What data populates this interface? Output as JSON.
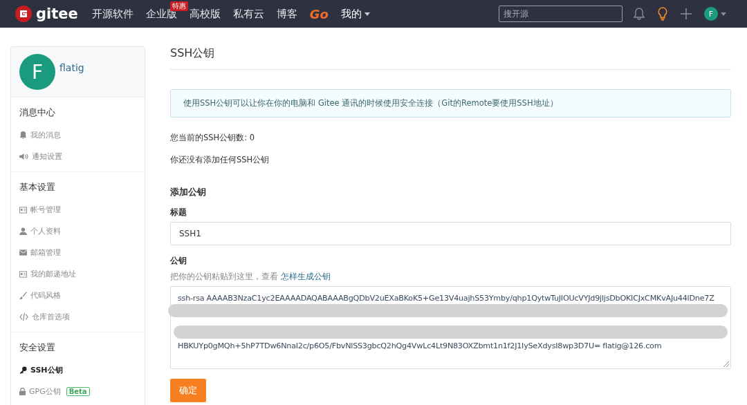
{
  "navbar": {
    "logo": "gitee",
    "items": [
      {
        "label": "开源软件",
        "kind": "plain"
      },
      {
        "label": "企业版",
        "kind": "plain",
        "badge": "特惠"
      },
      {
        "label": "高校版",
        "kind": "plain"
      },
      {
        "label": "私有云",
        "kind": "plain"
      },
      {
        "label": "博客",
        "kind": "plain"
      },
      {
        "label": "Go",
        "kind": "brand"
      },
      {
        "label": "我的",
        "kind": "dropdown"
      }
    ],
    "search": {
      "placeholder": "搜开源"
    },
    "avatar": "F"
  },
  "sidebar": {
    "avatar": "F",
    "username": "flatig",
    "sections": [
      {
        "title": "消息中心",
        "items": [
          {
            "label": "我的消息",
            "kind": "bell",
            "selected": false
          },
          {
            "label": "通知设置",
            "kind": "speaker",
            "selected": false
          }
        ]
      },
      {
        "title": "基本设置",
        "items": [
          {
            "label": "帐号管理",
            "kind": "card",
            "selected": false
          },
          {
            "label": "个人资料",
            "kind": "user",
            "selected": false
          },
          {
            "label": "邮箱管理",
            "kind": "mail",
            "selected": false
          },
          {
            "label": "我的邮递地址",
            "kind": "card",
            "selected": false
          },
          {
            "label": "代码风格",
            "kind": "brush",
            "selected": false
          },
          {
            "label": "仓库首选项",
            "kind": "code",
            "selected": false
          }
        ]
      },
      {
        "title": "安全设置",
        "items": [
          {
            "label": "SSH公钥",
            "kind": "key",
            "selected": true
          },
          {
            "label": "GPG公钥",
            "kind": "lock",
            "selected": false,
            "badge": "Beta"
          }
        ]
      }
    ]
  },
  "main": {
    "title": "SSH公钥",
    "alert": "使用SSH公钥可以让你在你的电脑和 Gitee 通讯的时候使用安全连接（Git的Remote要使用SSH地址）",
    "key_count": "您当前的SSH公钥数: 0",
    "empty_note": "你还没有添加任何SSH公钥",
    "form": {
      "heading": "添加公钥",
      "title_label": "标题",
      "title_value": "SSH1",
      "key_label": "公钥",
      "hint": "把你的公钥粘贴到这里，查看",
      "hint_link": "怎样生成公钥",
      "key_lines": [
        {
          "kind": "text",
          "text": "ssh-rsa AAAAB3NzaC1yc2EAAAADAQABAAABgQDbV2uEXaBKoK5+Ge13V4uajhS53Ymby/qhp1QytwTuJIOUcVYJd9jljsDbOKICJxCMKvAJu44lDne7Z"
        },
        {
          "kind": "redacted"
        },
        {
          "kind": "redacted"
        },
        {
          "kind": "text",
          "text": "HBKUYp0gMQh+5hP7TDw6NnaI2c/p6O5/FbvNlSS3gbcQ2hQg4VwLc4Lt9N83OXZbmt1n1f2J1IySeXdysI8wp3D7U= flatig@126.com"
        }
      ],
      "submit": "确定"
    }
  }
}
